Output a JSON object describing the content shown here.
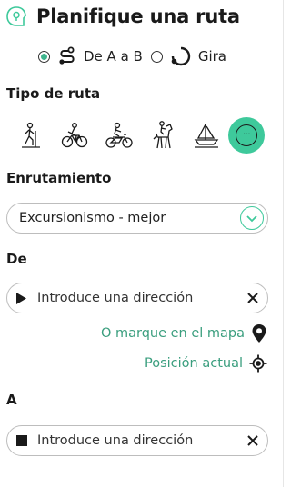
{
  "header": {
    "title": "Planifique una ruta"
  },
  "mode": {
    "option_ab": "De A a B",
    "option_tour": "Gira",
    "selected": "ab"
  },
  "route_type": {
    "label": "Tipo de ruta",
    "types": [
      "hiking-icon",
      "bicycle-icon",
      "motorbike-icon",
      "horse-riding-icon",
      "sailing-icon",
      "more-icon"
    ],
    "selected": "more-icon"
  },
  "routing": {
    "label": "Enrutamiento",
    "value": "Excursionismo - mejor"
  },
  "from": {
    "label": "De",
    "placeholder": "Introduce una dirección",
    "map_link": "O marque en el mapa",
    "location_link": "Posición actual"
  },
  "to": {
    "label": "A",
    "placeholder": "Introduce una dirección"
  },
  "colors": {
    "accent": "#3ec99b",
    "link": "#3a9e7e",
    "border": "#bdbdbd"
  }
}
